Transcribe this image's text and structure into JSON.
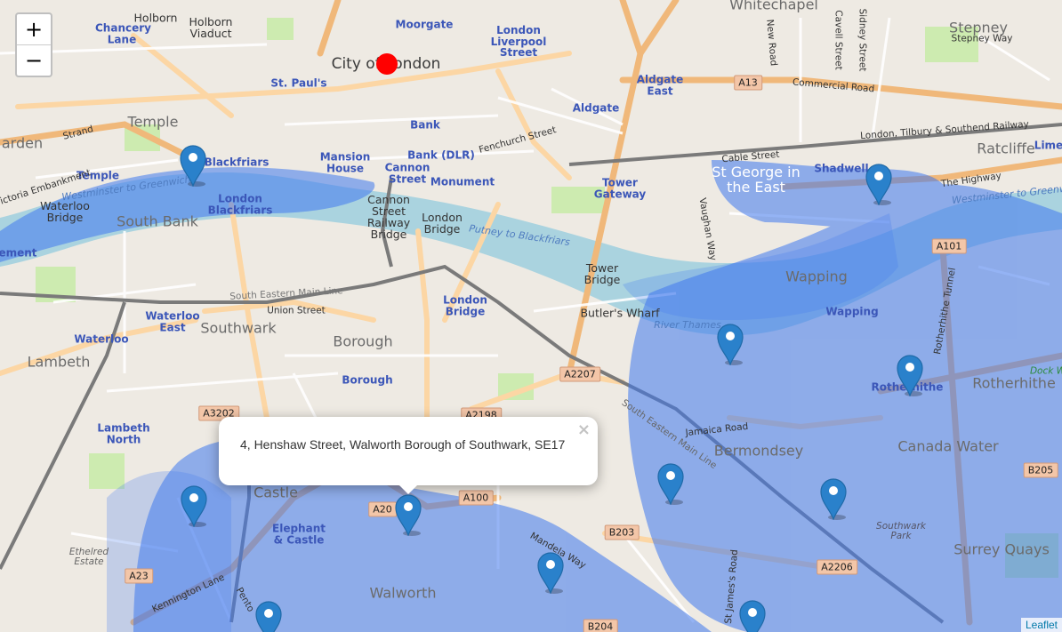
{
  "map": {
    "zoom_in_label": "+",
    "zoom_out_label": "−",
    "attribution": "Leaflet",
    "colors": {
      "water": "#aad3df",
      "heat": "#3f78ee",
      "marker": "#2a81cb",
      "dot": "#ff0000",
      "major_road": "#f0b87a",
      "primary": "#fcd6a4"
    }
  },
  "popup": {
    "text": "4, Henshaw Street, Walworth Borough of Southwark, SE17",
    "close_label": "×"
  },
  "labels": {
    "city_of_london": "City of London",
    "whitechapel": "Whitechapel",
    "stepney": "Stepney",
    "stepney_way": "Stepney Way",
    "temple": "Temple",
    "holborn": "Holborn",
    "holborn_viaduct": "Holborn Viaduct",
    "chancery_lane": "Chancery Lane",
    "moorgate": "Moorgate",
    "london_liverpool_street": "London Liverpool Street",
    "aldgate_east": "Aldgate East",
    "aldgate": "Aldgate",
    "st_pauls": "St. Paul's",
    "bank": "Bank",
    "bank_dlr": "Bank (DLR)",
    "mansion_house": "Mansion House",
    "cannon_street": "Cannon Street",
    "monument": "Monument",
    "tower_gateway": "Tower Gateway",
    "blackfriars": "Blackfriars",
    "temple_station": "Temple",
    "london_blackfriars": "London Blackfriars",
    "cannon_street_railway_bridge": "Cannon Street Railway Bridge",
    "london_bridge": "London Bridge",
    "london_bridge_station": "London Bridge",
    "tower_bridge": "Tower Bridge",
    "butlers_wharf": "Butler's Wharf",
    "waterloo_bridge": "Waterloo Bridge",
    "south_bank": "South Bank",
    "waterloo_east": "Waterloo East",
    "waterloo": "Waterloo",
    "southwark": "Southwark",
    "borough": "Borough",
    "borough_station": "Borough",
    "lambeth": "Lambeth",
    "lambeth_north": "Lambeth North",
    "castle": "Castle",
    "elephant_castle": "Elephant & Castle",
    "walworth": "Walworth",
    "ethelred_estate": "Ethelred Estate",
    "bermondsey": "Bermondsey",
    "canada_water": "Canada Water",
    "southwark_park": "Southwark Park",
    "surrey_quays": "Surrey Quays",
    "rotherhithe": "Rotherhithe",
    "rotherhithe_station": "Rotherhithe",
    "wapping": "Wapping",
    "wapping_station": "Wapping",
    "st_george_in_the_east": "St George in the East",
    "shadwell": "Shadwell",
    "ratcliffe": "Ratcliffe",
    "limehouse": "Lime",
    "arden": "arden",
    "dock": "Dock W",
    "ement": "ement",
    "strand": "Strand",
    "fenchurch_street": "Fenchurch Street",
    "cable_street": "Cable Street",
    "commercial_road": "Commercial Road",
    "the_highway": "The Highway",
    "lt_railway": "London, Tilbury & Southend Railway",
    "south_eastern_main_line": "South Eastern Main Line",
    "union_street": "Union Street",
    "jamaica_road": "Jamaica Road",
    "kennington_lane": "Kennington Lane",
    "new_road": "New Road",
    "cavell_street": "Cavell Street",
    "sidney_street": "Sidney Street",
    "vaughan_way": "Vaughan Way",
    "rotherhithe_tunnel": "Rotherhithe Tunnel",
    "south_eastern_main_line_2": "South Eastern Main Line",
    "st_james_road": "St James's Road",
    "victoria_embankment": "Victoria Embankment",
    "westminster_to_greenwich": "Westminster to Greenwich",
    "westminster_to_greenwich_2": "Westminster to Greenw",
    "putney_to_blackfriars": "Putney to Blackfriars",
    "river_thames": "River Thames",
    "mandela_way": "Mandela Way",
    "pentonville": "Pento",
    "a13": "A13",
    "a101": "A101",
    "a2207": "A2207",
    "a3202": "A3202",
    "a2198": "A2198",
    "a100": "A100",
    "a201": "A20",
    "b203": "B203",
    "b204": "B204",
    "b205": "B205",
    "a2206": "A2206",
    "a23": "A23"
  }
}
